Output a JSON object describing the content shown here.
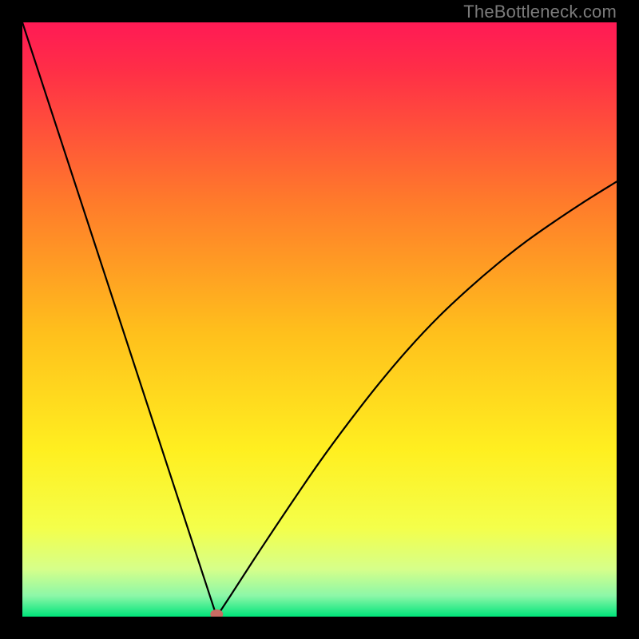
{
  "attribution": "TheBottleneck.com",
  "chart_data": {
    "type": "line",
    "title": "",
    "xlabel": "",
    "ylabel": "",
    "xlim": [
      0,
      1
    ],
    "ylim": [
      0,
      1
    ],
    "x": [
      0.0,
      0.05,
      0.1,
      0.15,
      0.2,
      0.25,
      0.3,
      0.327,
      0.35,
      0.4,
      0.45,
      0.5,
      0.55,
      0.6,
      0.65,
      0.7,
      0.75,
      0.8,
      0.85,
      0.9,
      0.95,
      1.0
    ],
    "values": [
      1.0,
      0.847,
      0.694,
      0.541,
      0.388,
      0.235,
      0.082,
      0.0,
      0.035,
      0.112,
      0.187,
      0.26,
      0.328,
      0.392,
      0.451,
      0.504,
      0.551,
      0.594,
      0.633,
      0.668,
      0.701,
      0.732
    ],
    "minimum_marker": {
      "x": 0.327,
      "y": 0.0
    },
    "gradient_stops": [
      {
        "pos": 0.0,
        "color": "#ff1a55"
      },
      {
        "pos": 0.08,
        "color": "#ff2e47"
      },
      {
        "pos": 0.3,
        "color": "#ff7a2b"
      },
      {
        "pos": 0.52,
        "color": "#ffbf1c"
      },
      {
        "pos": 0.72,
        "color": "#ffef20"
      },
      {
        "pos": 0.85,
        "color": "#f4ff4a"
      },
      {
        "pos": 0.92,
        "color": "#d6ff8a"
      },
      {
        "pos": 0.965,
        "color": "#8cf7a8"
      },
      {
        "pos": 1.0,
        "color": "#00e47a"
      }
    ]
  }
}
